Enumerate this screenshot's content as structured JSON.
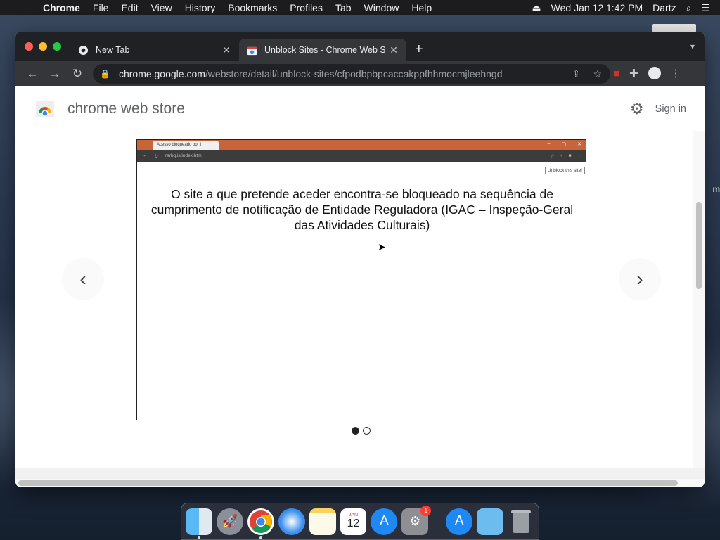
{
  "menubar": {
    "app": "Chrome",
    "items": [
      "File",
      "Edit",
      "View",
      "History",
      "Bookmarks",
      "Profiles",
      "Tab",
      "Window",
      "Help"
    ],
    "datetime": "Wed Jan 12  1:42 PM",
    "user": "Dartz"
  },
  "tabs": [
    {
      "title": "New Tab",
      "active": false
    },
    {
      "title": "Unblock Sites - Chrome Web S",
      "active": true
    }
  ],
  "omnibox": {
    "domain": "chrome.google.com",
    "path": "/webstore/detail/unblock-sites/cfpodbpbpcaccakppfhhmocmjleehngd"
  },
  "store": {
    "title": "chrome web store",
    "signin": "Sign in"
  },
  "screenshot": {
    "tab_title": "Acesso bloqueado por I",
    "url": "rarbg.is/index.html",
    "tooltip": "Unblock this site!",
    "message": "O site a que pretende aceder encontra-se bloqueado na sequência de cumprimento de notificação de Entidade Reguladora (IGAC – Inspeção-Geral das Atividades Culturais)"
  },
  "carousel": {
    "total": 2,
    "current": 1
  },
  "dock": {
    "apps": [
      "Finder",
      "Launchpad",
      "Chrome",
      "Safari",
      "Notes",
      "Calendar",
      "App Store",
      "System Preferences"
    ],
    "calendar_month": "JAN",
    "calendar_day": "12",
    "prefs_badge": "1"
  },
  "colors": {
    "menubar": "#1c1c1e",
    "tabstrip": "#202124",
    "toolbar": "#35363a",
    "shot_tabbar": "#c8643a"
  }
}
